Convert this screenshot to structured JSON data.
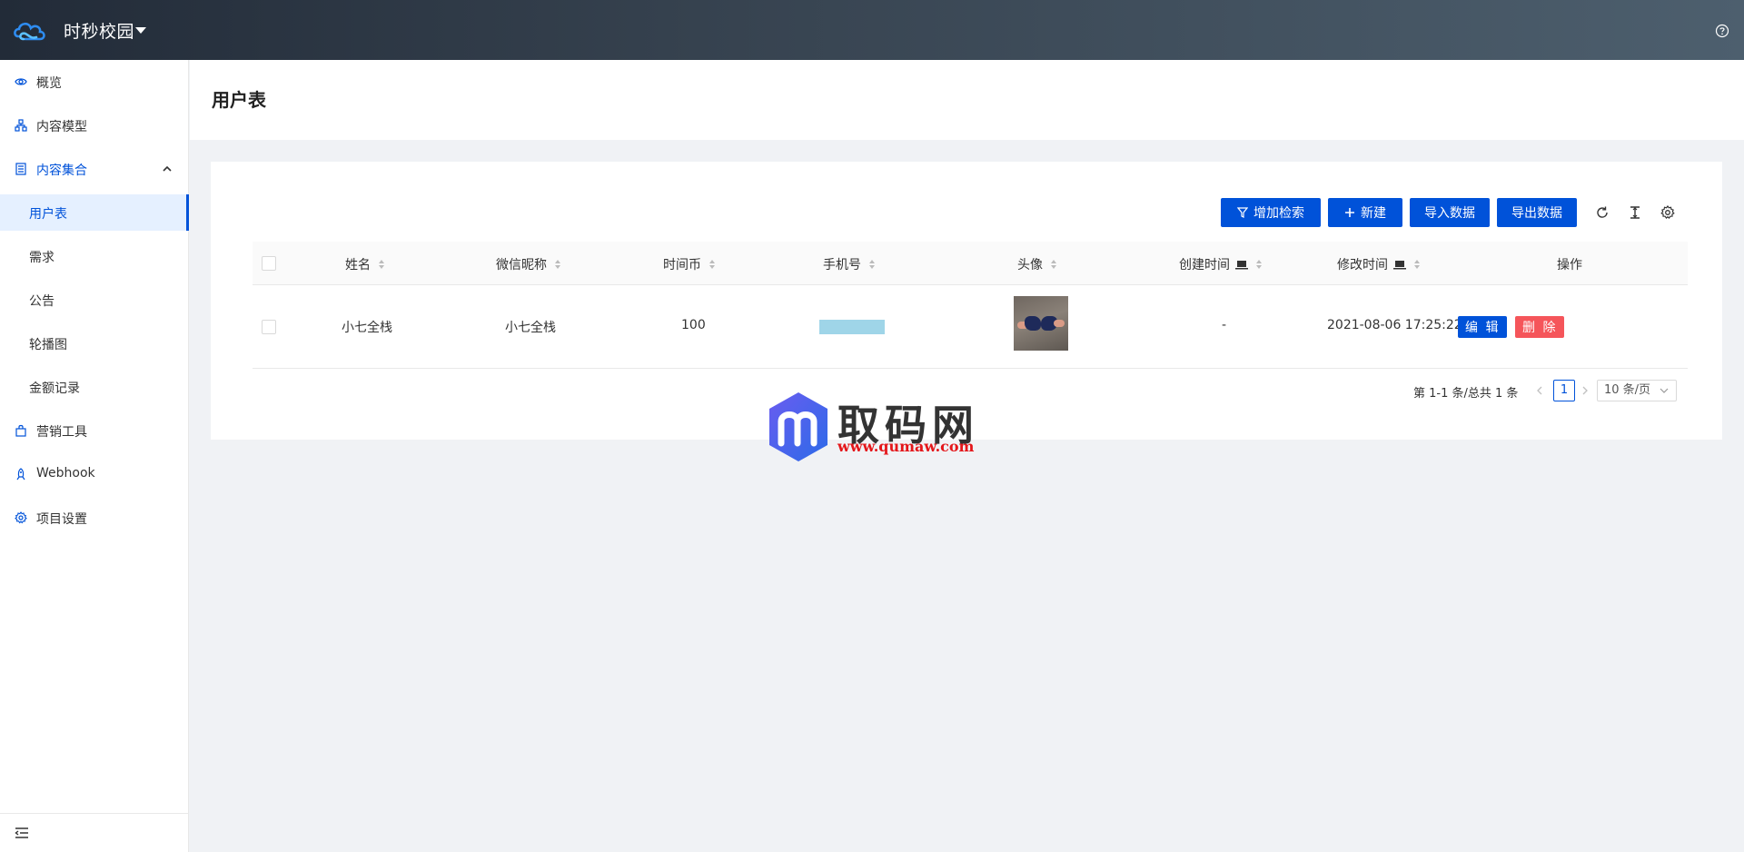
{
  "app": {
    "title": "时秒校园"
  },
  "sidebar": {
    "items": [
      {
        "label": "概览",
        "icon": "eye-icon"
      },
      {
        "label": "内容模型",
        "icon": "model-icon"
      },
      {
        "label": "内容集合",
        "icon": "collection-icon"
      },
      {
        "label": "用户表"
      },
      {
        "label": "需求"
      },
      {
        "label": "公告"
      },
      {
        "label": "轮播图"
      },
      {
        "label": "金额记录"
      },
      {
        "label": "营销工具",
        "icon": "bag-icon"
      },
      {
        "label": "Webhook",
        "icon": "rocket-icon"
      },
      {
        "label": "项目设置",
        "icon": "gear-icon"
      }
    ]
  },
  "page": {
    "title": "用户表"
  },
  "toolbar": {
    "filter_label": "增加检索",
    "new_label": "新建",
    "import_label": "导入数据",
    "export_label": "导出数据"
  },
  "table": {
    "headers": [
      "姓名",
      "微信昵称",
      "时间币",
      "手机号",
      "头像",
      "创建时间",
      "修改时间",
      "操作"
    ],
    "rows": [
      {
        "name": "小七全栈",
        "nickname": "小七全栈",
        "coins": "100",
        "created": "-",
        "modified": "2021-08-06 17:25:22",
        "edit_label": "编 辑",
        "delete_label": "删 除"
      }
    ]
  },
  "pagination": {
    "total_text": "第 1-1 条/总共 1 条",
    "current_page": "1",
    "page_size": "10 条/页"
  },
  "watermark": {
    "brand": "取码网",
    "url": "www.qumaw.com"
  },
  "colors": {
    "primary": "#0052d9",
    "danger": "#f5555a",
    "header_start": "#222b38",
    "header_end": "#4d5f6e"
  }
}
